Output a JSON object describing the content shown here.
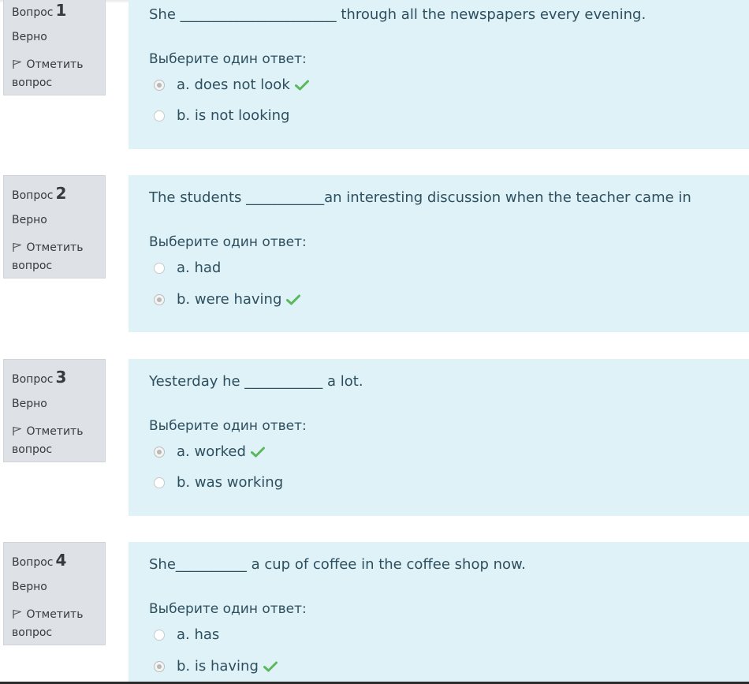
{
  "questions": [
    {
      "label": "Вопрос",
      "number": "1",
      "state": "Верно",
      "flag": "Отметить вопрос",
      "text": "She ______________________ through all the newspapers every evening.",
      "prompt": "Выберите один ответ:",
      "options": [
        {
          "label": "a. does not look",
          "selected": true,
          "correct": true
        },
        {
          "label": "b. is not looking",
          "selected": false,
          "correct": false
        }
      ]
    },
    {
      "label": "Вопрос",
      "number": "2",
      "state": "Верно",
      "flag": "Отметить вопрос",
      "text": "The students ___________an interesting discussion when the teacher came in",
      "prompt": "Выберите один ответ:",
      "options": [
        {
          "label": "a. had",
          "selected": false,
          "correct": false
        },
        {
          "label": "b. were having",
          "selected": true,
          "correct": true
        }
      ]
    },
    {
      "label": "Вопрос",
      "number": "3",
      "state": "Верно",
      "flag": "Отметить вопрос",
      "text": "Yesterday he ___________ a lot.",
      "prompt": "Выберите один ответ:",
      "options": [
        {
          "label": "a. worked",
          "selected": true,
          "correct": true
        },
        {
          "label": "b. was working",
          "selected": false,
          "correct": false
        }
      ]
    },
    {
      "label": "Вопрос",
      "number": "4",
      "state": "Верно",
      "flag": "Отметить вопрос",
      "text": "She__________ a cup of coffee in the coffee shop now.",
      "prompt": "Выберите один ответ:",
      "options": [
        {
          "label": "a. has",
          "selected": false,
          "correct": false
        },
        {
          "label": "b. is having",
          "selected": true,
          "correct": true
        }
      ]
    }
  ],
  "colors": {
    "panel": "#def2f8",
    "info": "#dee2e6",
    "correct": "#5cb85c"
  },
  "icons": {
    "flag": "flag-icon",
    "correct": "check-icon"
  }
}
